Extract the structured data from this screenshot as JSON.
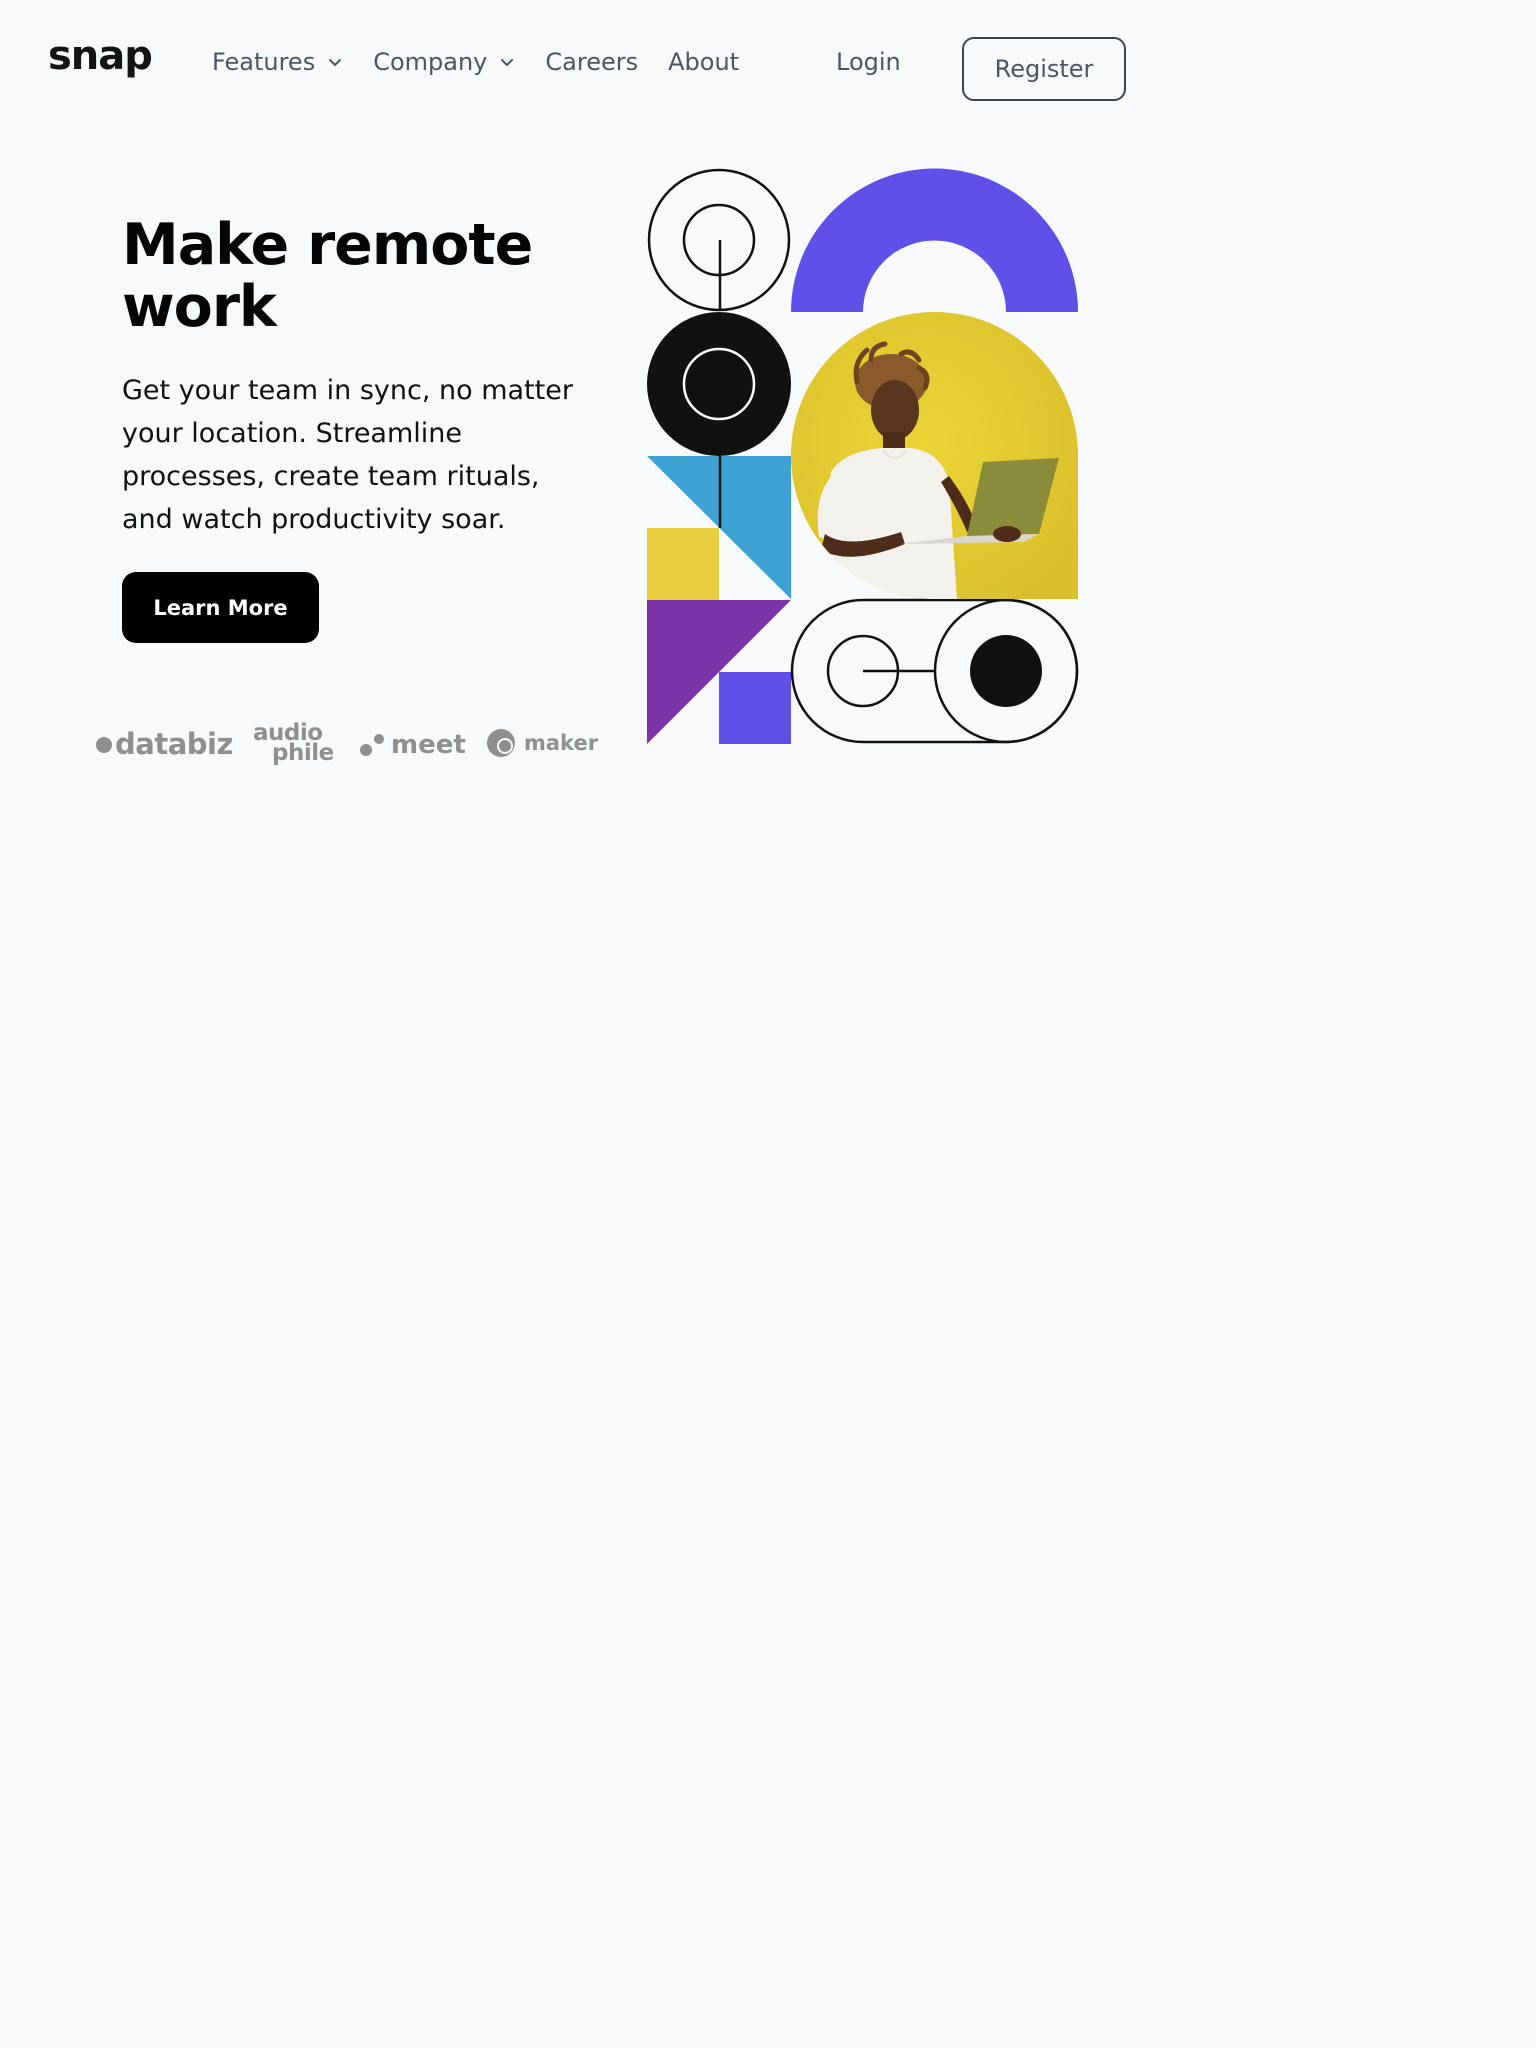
{
  "brand": {
    "logo": "snap"
  },
  "nav": {
    "items": [
      {
        "label": "Features",
        "has_dropdown": true
      },
      {
        "label": "Company",
        "has_dropdown": true
      },
      {
        "label": "Careers",
        "has_dropdown": false
      },
      {
        "label": "About",
        "has_dropdown": false
      }
    ],
    "login_label": "Login",
    "register_label": "Register"
  },
  "hero": {
    "title_line1": "Make remote",
    "title_line2": "work",
    "body": "Get your team in sync, no matter your location. Streamline processes, create team rituals, and watch productivity soar.",
    "cta_label": "Learn More"
  },
  "clients": {
    "databiz": "databiz",
    "audiophile_top": "audio",
    "audiophile_bottom": "phile",
    "meet": "meet",
    "maker": "maker"
  },
  "colors": {
    "background": "#f8f9fb",
    "text": "#050505",
    "nav_text": "#4a5566",
    "button_bg": "#000000",
    "client_gray": "#8f8f8f",
    "indigo": "#5f50e8",
    "yellow": "#e8cd3c",
    "blue": "#3da2d4",
    "purple": "#7a32a6"
  },
  "icons": {
    "dropdown": "chevron-down-icon"
  }
}
